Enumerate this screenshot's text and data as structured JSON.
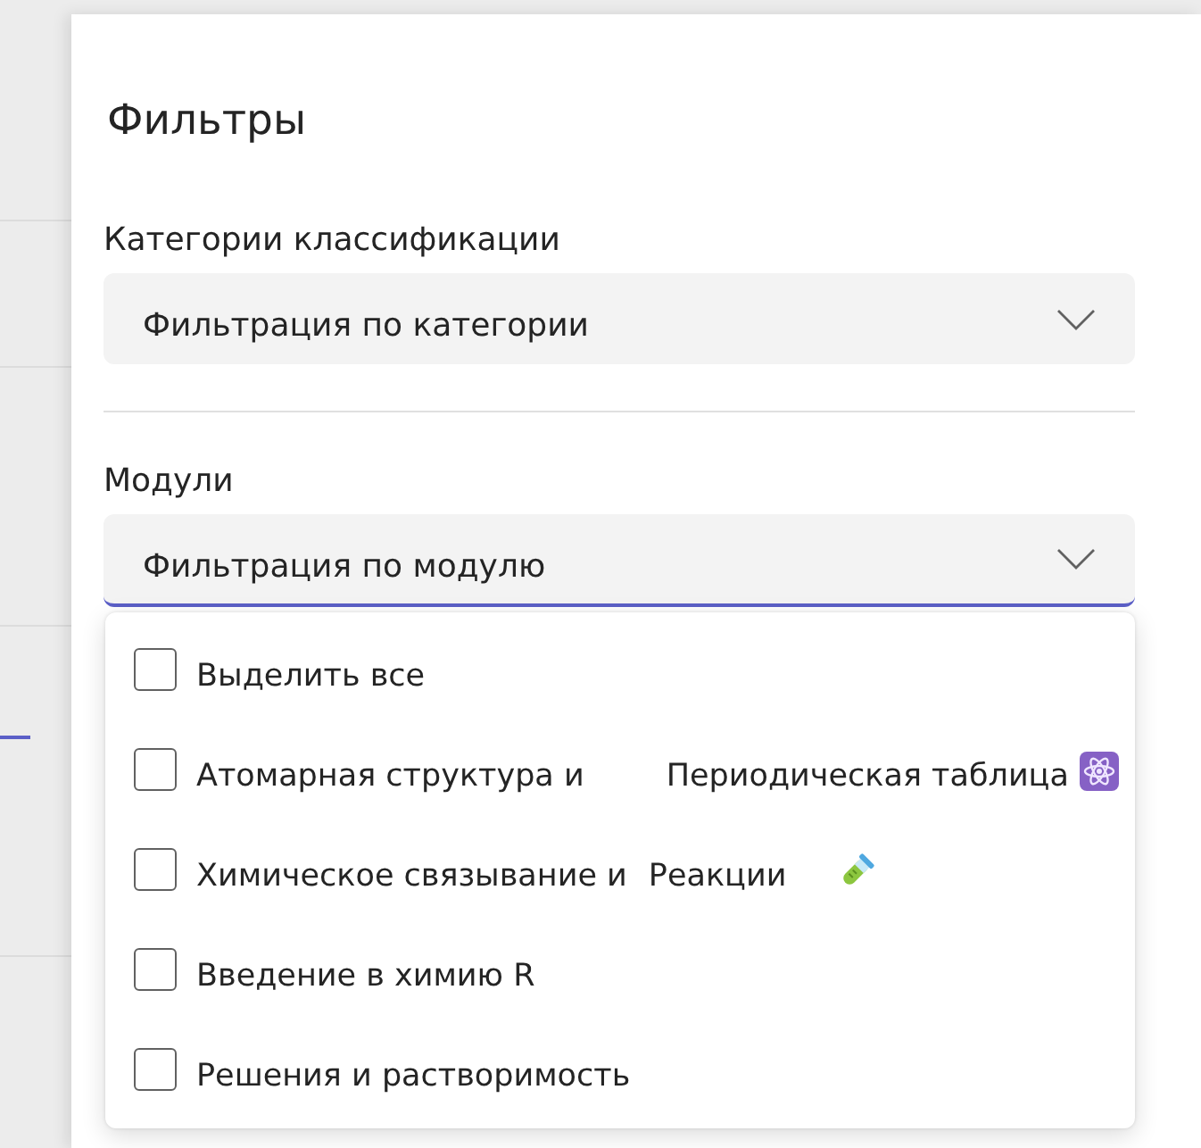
{
  "panel": {
    "title": "Фильтры"
  },
  "filters": [
    {
      "label": "Категории классификации",
      "dropdown": {
        "value": "Фильтрация по категории",
        "expanded": false
      }
    },
    {
      "label": "Модули",
      "dropdown": {
        "value": "Фильтрация по модулю",
        "expanded": true,
        "options": [
          {
            "kind": "plain",
            "parts": [
              "Выделить все"
            ],
            "checked": false
          },
          {
            "kind": "atom",
            "parts": [
              "Атомарная структура и",
              "Периодическая таблица"
            ],
            "checked": false
          },
          {
            "kind": "tube",
            "parts": [
              "Химическое связывание и",
              "Реакции"
            ],
            "checked": false
          },
          {
            "kind": "plain",
            "parts": [
              "Введение в химию R"
            ],
            "checked": false
          },
          {
            "kind": "plain",
            "parts": [
              "Решения и растворимость"
            ],
            "checked": false
          }
        ]
      }
    }
  ]
}
